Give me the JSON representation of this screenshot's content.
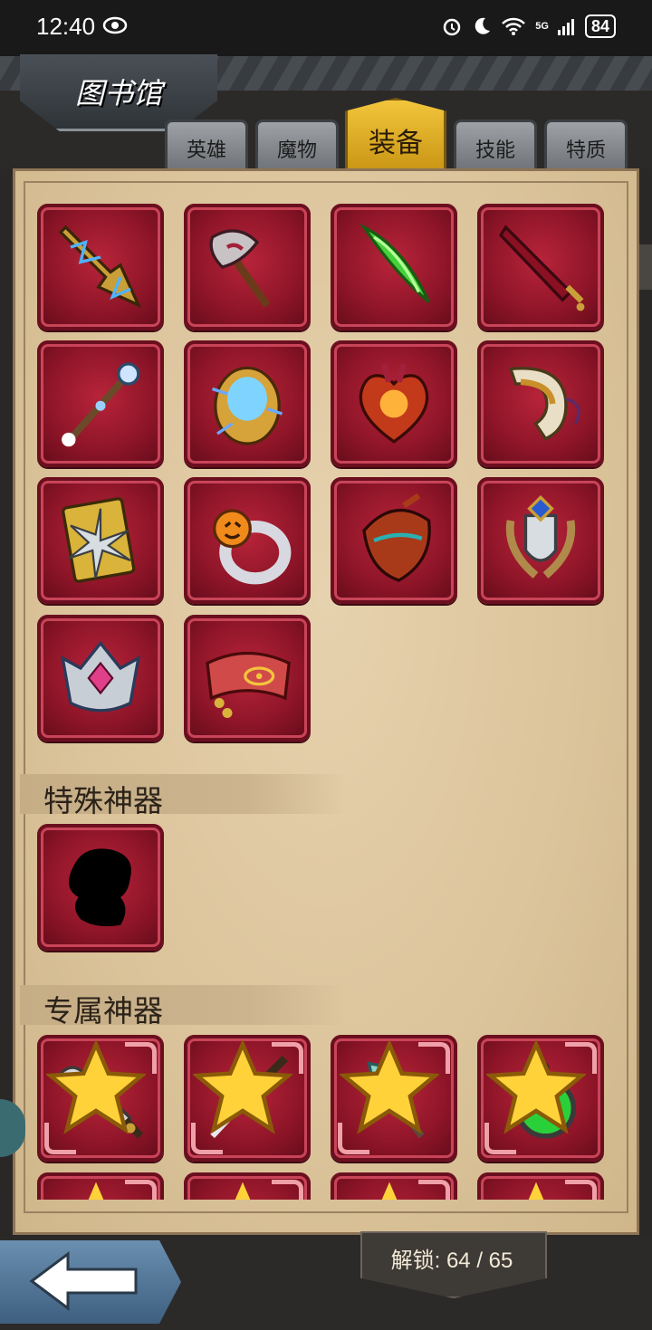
{
  "status_bar": {
    "time": "12:40",
    "network": "5G",
    "battery": "84"
  },
  "header": {
    "title": "图书馆"
  },
  "tabs": [
    {
      "label": "英雄",
      "active": false
    },
    {
      "label": "魔物",
      "active": false
    },
    {
      "label": "装备",
      "active": true
    },
    {
      "label": "技能",
      "active": false
    },
    {
      "label": "特质",
      "active": false
    }
  ],
  "equipment": {
    "items": [
      {
        "icon": "lightning-spear-icon"
      },
      {
        "icon": "battle-axe-icon"
      },
      {
        "icon": "green-blade-icon"
      },
      {
        "icon": "crimson-sword-icon"
      },
      {
        "icon": "ice-staff-icon"
      },
      {
        "icon": "blue-egg-orb-icon"
      },
      {
        "icon": "magma-heart-icon"
      },
      {
        "icon": "horn-icon"
      },
      {
        "icon": "spiked-shield-icon"
      },
      {
        "icon": "pumpkin-ring-icon"
      },
      {
        "icon": "demon-helm-icon"
      },
      {
        "icon": "laurel-shield-emblem-icon"
      },
      {
        "icon": "gem-crown-icon"
      },
      {
        "icon": "eye-headband-icon"
      }
    ]
  },
  "special_artifacts": {
    "title": "特殊神器",
    "items": [
      {
        "icon": "locked-silhouette-icon"
      }
    ]
  },
  "exclusive_artifacts": {
    "title": "专属神器",
    "items": [
      {
        "icon": "cleaver-sword-icon"
      },
      {
        "icon": "katana-icon"
      },
      {
        "icon": "crystal-scepter-icon"
      },
      {
        "icon": "green-potion-icon"
      },
      {
        "icon": "partial-item-icon"
      },
      {
        "icon": "partial-item-icon"
      },
      {
        "icon": "partial-item-icon"
      },
      {
        "icon": "partial-item-icon"
      }
    ]
  },
  "footer": {
    "unlock_label": "解锁: 64 / 65"
  },
  "colors": {
    "slot_red": "#a11c31",
    "parchment": "#e0caa4",
    "tab_active": "#e2b02a",
    "tab_inactive": "#8a8e92"
  }
}
